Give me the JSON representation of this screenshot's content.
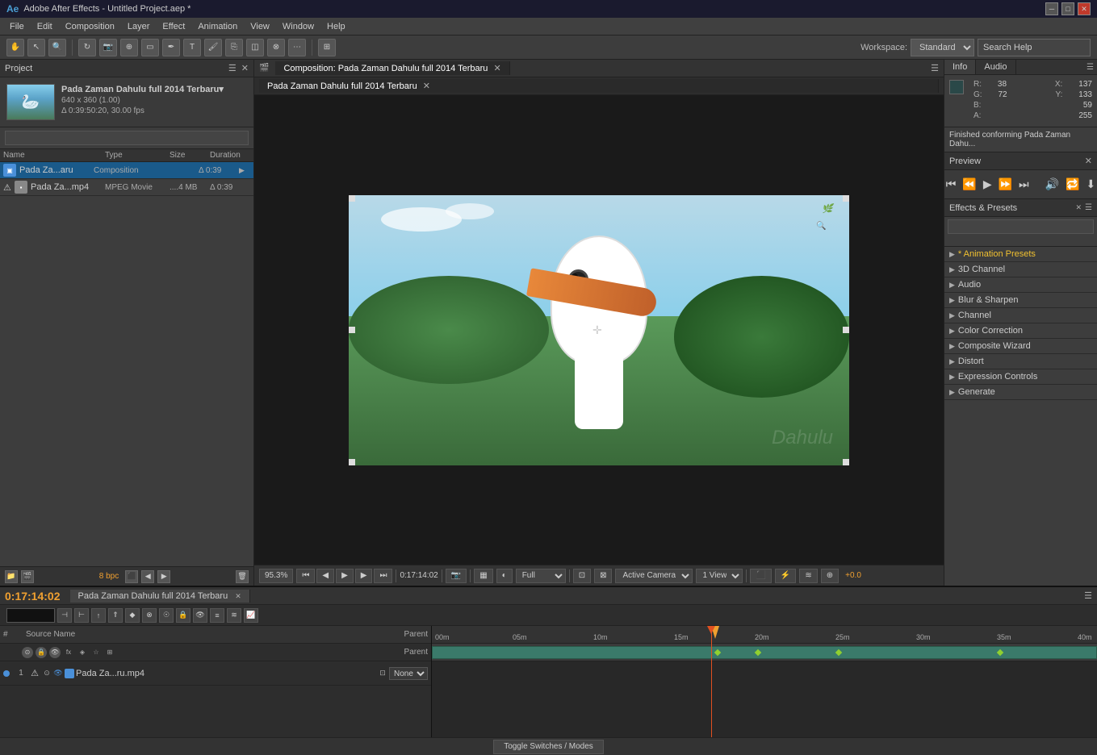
{
  "titlebar": {
    "title": "Adobe After Effects - Untitled Project.aep *",
    "minimize": "─",
    "maximize": "□",
    "close": "✕"
  },
  "menubar": {
    "items": [
      "File",
      "Edit",
      "Composition",
      "Layer",
      "Effect",
      "Animation",
      "View",
      "Window",
      "Help"
    ]
  },
  "toolbar": {
    "workspace_label": "Workspace:",
    "workspace_value": "Standard",
    "search_placeholder": "Search Help",
    "search_label": "Search Help"
  },
  "project": {
    "title": "Project",
    "preview_item_name": "Pada Zaman Dahulu full 2014 Terbaru▾",
    "preview_item_detail1": "640 x 360 (1.00)",
    "preview_item_detail2": "Δ 0:39:50:20, 30.00 fps",
    "search_placeholder": "",
    "bpc": "8 bpc",
    "columns": {
      "name": "Name",
      "type": "Type",
      "size": "Size",
      "duration": "Duration"
    },
    "items": [
      {
        "name": "Pada Za...aru",
        "type": "Composition",
        "size": "",
        "duration": "Δ 0:39",
        "kind": "composition"
      },
      {
        "name": "Pada Za...mp4",
        "type": "MPEG Movie",
        "size": "....4 MB",
        "duration": "Δ 0:39",
        "kind": "movie"
      }
    ]
  },
  "composition": {
    "tab_label": "Composition: Pada Zaman Dahulu full 2014 Terbaru",
    "viewer_tab": "Pada Zaman Dahulu full 2014 Terbaru",
    "zoom": "95.3%",
    "timecode": "0:17:14:02",
    "quality": "Full",
    "active_camera_label": "Active Camera",
    "view_label": "1 View",
    "offset": "+0.0"
  },
  "info_panel": {
    "title": "Info",
    "audio_tab": "Audio",
    "r_label": "R:",
    "r_value": "38",
    "x_label": "X:",
    "x_value": "137",
    "g_label": "G:",
    "g_value": "72",
    "y_label": "Y:",
    "y_value": "133",
    "b_label": "B:",
    "b_value": "59",
    "a_label": "A:",
    "a_value": "255",
    "message": "Finished conforming Pada Zaman Dahu..."
  },
  "preview_panel": {
    "title": "Preview"
  },
  "effects_panel": {
    "title": "Effects & Presets",
    "search_placeholder": "",
    "categories": [
      {
        "name": "* Animation Presets",
        "highlighted": true
      },
      {
        "name": "3D Channel",
        "highlighted": false
      },
      {
        "name": "Audio",
        "highlighted": false
      },
      {
        "name": "Blur & Sharpen",
        "highlighted": false
      },
      {
        "name": "Channel",
        "highlighted": false
      },
      {
        "name": "Color Correction",
        "highlighted": false
      },
      {
        "name": "Composite Wizard",
        "highlighted": false
      },
      {
        "name": "Distort",
        "highlighted": false
      },
      {
        "name": "Expression Controls",
        "highlighted": false
      },
      {
        "name": "Generate",
        "highlighted": false
      }
    ]
  },
  "timeline": {
    "tab_label": "Pada Zaman Dahulu full 2014 Terbaru",
    "timecode": "0:17:14:02",
    "columns": {
      "source_name": "Source Name",
      "parent": "Parent"
    },
    "layers": [
      {
        "num": "1",
        "name": "Pada Za...ru.mp4",
        "parent": "None",
        "solo": false
      }
    ],
    "time_marks": [
      "00m",
      "05m",
      "10m",
      "15m",
      "20m",
      "25m",
      "30m",
      "35m",
      "40m"
    ],
    "playhead_pos": "0:17:14:02",
    "toggle_label": "Toggle Switches / Modes"
  }
}
